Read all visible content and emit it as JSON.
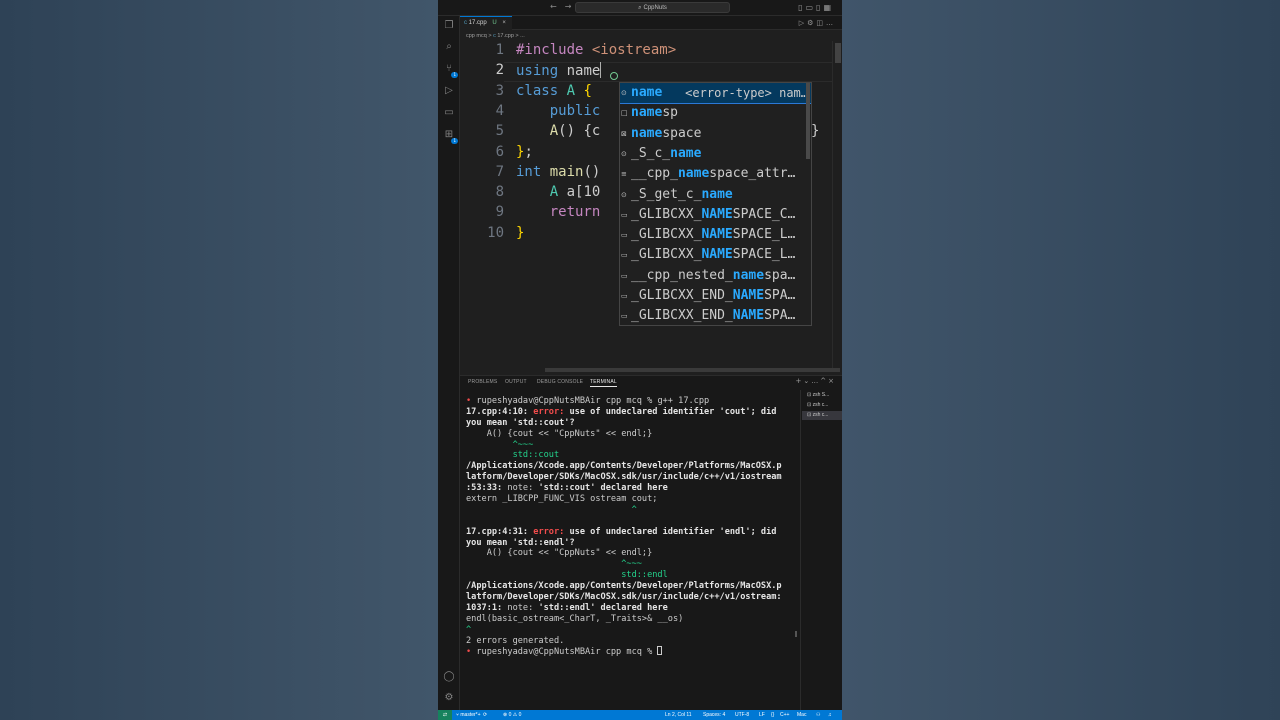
{
  "window": {
    "title": "CppNuts"
  },
  "tab": {
    "filename": "17.cpp",
    "status": "U",
    "close": "×"
  },
  "breadcrumb": {
    "folder": "cpp mcq",
    "sep": ">",
    "file": "17.cpp",
    "tail": "> ..."
  },
  "editor": {
    "lines": [
      {
        "n": "1",
        "parts": [
          [
            "kw-inc",
            "#include "
          ],
          [
            "str-inc",
            "<iostream>"
          ]
        ]
      },
      {
        "n": "2",
        "parts": [
          [
            "kw",
            "using"
          ],
          [
            "plain",
            " name"
          ]
        ]
      },
      {
        "n": "3",
        "parts": [
          [
            "kw",
            "class"
          ],
          [
            "plain",
            " "
          ],
          [
            "cls",
            "A"
          ],
          [
            "plain",
            " "
          ],
          [
            "brk",
            "{"
          ]
        ]
      },
      {
        "n": "4",
        "parts": [
          [
            "plain",
            "    "
          ],
          [
            "kw",
            "public"
          ]
        ]
      },
      {
        "n": "5",
        "parts": [
          [
            "plain",
            "    "
          ],
          [
            "fn",
            "A"
          ],
          [
            "plain",
            "() {c"
          ],
          [
            "plain",
            "                        ;}"
          ]
        ]
      },
      {
        "n": "6",
        "parts": [
          [
            "brk",
            "}"
          ],
          [
            "plain",
            ";"
          ]
        ]
      },
      {
        "n": "7",
        "parts": [
          [
            "kw",
            "int"
          ],
          [
            "plain",
            " "
          ],
          [
            "fn",
            "main"
          ],
          [
            "plain",
            "()"
          ]
        ]
      },
      {
        "n": "8",
        "parts": [
          [
            "plain",
            "    "
          ],
          [
            "cls",
            "A"
          ],
          [
            "plain",
            " a[10"
          ]
        ]
      },
      {
        "n": "9",
        "parts": [
          [
            "plain",
            "    "
          ],
          [
            "kw-inc",
            "return"
          ]
        ]
      },
      {
        "n": "10",
        "parts": [
          [
            "brk",
            "}"
          ]
        ]
      }
    ]
  },
  "suggest": {
    "items": [
      {
        "icon": "⊙",
        "pre": "",
        "match": "name",
        "post": "",
        "detail": "<error-type> nam…",
        "selected": true
      },
      {
        "icon": "□",
        "pre": "",
        "match": "name",
        "post": "sp",
        "detail": ""
      },
      {
        "icon": "⊠",
        "pre": "",
        "match": "name",
        "post": "space",
        "detail": ""
      },
      {
        "icon": "⊙",
        "pre": "_S_c_",
        "match": "name",
        "post": "",
        "detail": ""
      },
      {
        "icon": "≡",
        "pre": "__cpp_",
        "match": "name",
        "post": "space_attr…",
        "detail": ""
      },
      {
        "icon": "⊙",
        "pre": "_S_get_c_",
        "match": "name",
        "post": "",
        "detail": ""
      },
      {
        "icon": "▭",
        "pre": "_GLIBCXX_",
        "match": "NAME",
        "post": "SPACE_C…",
        "detail": ""
      },
      {
        "icon": "▭",
        "pre": "_GLIBCXX_",
        "match": "NAME",
        "post": "SPACE_L…",
        "detail": ""
      },
      {
        "icon": "▭",
        "pre": "_GLIBCXX_",
        "match": "NAME",
        "post": "SPACE_L…",
        "detail": ""
      },
      {
        "icon": "▭",
        "pre": "__cpp_nested_",
        "match": "name",
        "post": "spa…",
        "detail": ""
      },
      {
        "icon": "▭",
        "pre": "_GLIBCXX_END_",
        "match": "NAME",
        "post": "SPA…",
        "detail": ""
      },
      {
        "icon": "▭",
        "pre": "_GLIBCXX_END_",
        "match": "NAME",
        "post": "SPA…",
        "detail": ""
      }
    ]
  },
  "panel": {
    "tabs": [
      "PROBLEMS",
      "OUTPUT",
      "DEBUG CONSOLE",
      "TERMINAL"
    ],
    "active_tab": "TERMINAL",
    "terminal_sessions": [
      "zsh S...",
      "zsh c...",
      "zsh c..."
    ],
    "terminal_lines": [
      [
        [
          "t-dot",
          "• "
        ],
        [
          "plain",
          "rupeshyadav@CppNutsMBAir cpp mcq % g++ 17.cpp"
        ]
      ],
      [
        [
          "t-bold",
          "17.cpp:4:10: "
        ],
        [
          "t-err",
          "error: "
        ],
        [
          "t-bold",
          "use of undeclared identifier 'cout'; did"
        ]
      ],
      [
        [
          "t-bold",
          "you mean 'std::cout'?"
        ]
      ],
      [
        [
          "plain",
          "    A() {cout << \"CppNuts\" << endl;}"
        ]
      ],
      [
        [
          "t-green",
          "         ^~~~"
        ]
      ],
      [
        [
          "t-green",
          "         std::cout"
        ]
      ],
      [
        [
          "t-bold",
          "/Applications/Xcode.app/Contents/Developer/Platforms/MacOSX.p"
        ]
      ],
      [
        [
          "t-bold",
          "latform/Developer/SDKs/MacOSX.sdk/usr/include/c++/v1/iostream"
        ]
      ],
      [
        [
          "t-bold",
          ":53:33: "
        ],
        [
          "t-note",
          "note: "
        ],
        [
          "t-bold",
          "'std::cout' declared here"
        ]
      ],
      [
        [
          "plain",
          "extern _LIBCPP_FUNC_VIS ostream cout;"
        ]
      ],
      [
        [
          "t-green",
          "                                ^"
        ]
      ],
      [
        [
          "plain",
          ""
        ]
      ],
      [
        [
          "t-bold",
          "17.cpp:4:31: "
        ],
        [
          "t-err",
          "error: "
        ],
        [
          "t-bold",
          "use of undeclared identifier 'endl'; did"
        ]
      ],
      [
        [
          "t-bold",
          "you mean 'std::endl'?"
        ]
      ],
      [
        [
          "plain",
          "    A() {cout << \"CppNuts\" << endl;}"
        ]
      ],
      [
        [
          "t-green",
          "                              ^~~~"
        ]
      ],
      [
        [
          "t-green",
          "                              std::endl"
        ]
      ],
      [
        [
          "t-bold",
          "/Applications/Xcode.app/Contents/Developer/Platforms/MacOSX.p"
        ]
      ],
      [
        [
          "t-bold",
          "latform/Developer/SDKs/MacOSX.sdk/usr/include/c++/v1/ostream:"
        ]
      ],
      [
        [
          "t-bold",
          "1037:1: "
        ],
        [
          "t-note",
          "note: "
        ],
        [
          "t-bold",
          "'std::endl' declared here"
        ]
      ],
      [
        [
          "plain",
          "endl(basic_ostream<_CharT, _Traits>& __os)"
        ]
      ],
      [
        [
          "t-green",
          "^"
        ]
      ],
      [
        [
          "plain",
          "2 errors generated."
        ]
      ],
      [
        [
          "t-dot",
          "• "
        ],
        [
          "plain",
          "rupeshyadav@CppNutsMBAir cpp mcq % "
        ]
      ]
    ]
  },
  "status": {
    "branch": "master*+",
    "problems": "⊗ 0 ⚠ 0",
    "position": "Ln 2, Col 11",
    "spaces": "Spaces: 4",
    "encoding": "UTF-8",
    "eol": "LF",
    "language": "C++",
    "platform": "Mac"
  },
  "colors": {
    "accent": "#0078d4",
    "match": "#2aaaff",
    "error": "#f14c4c",
    "terminal_green": "#23d18b"
  }
}
